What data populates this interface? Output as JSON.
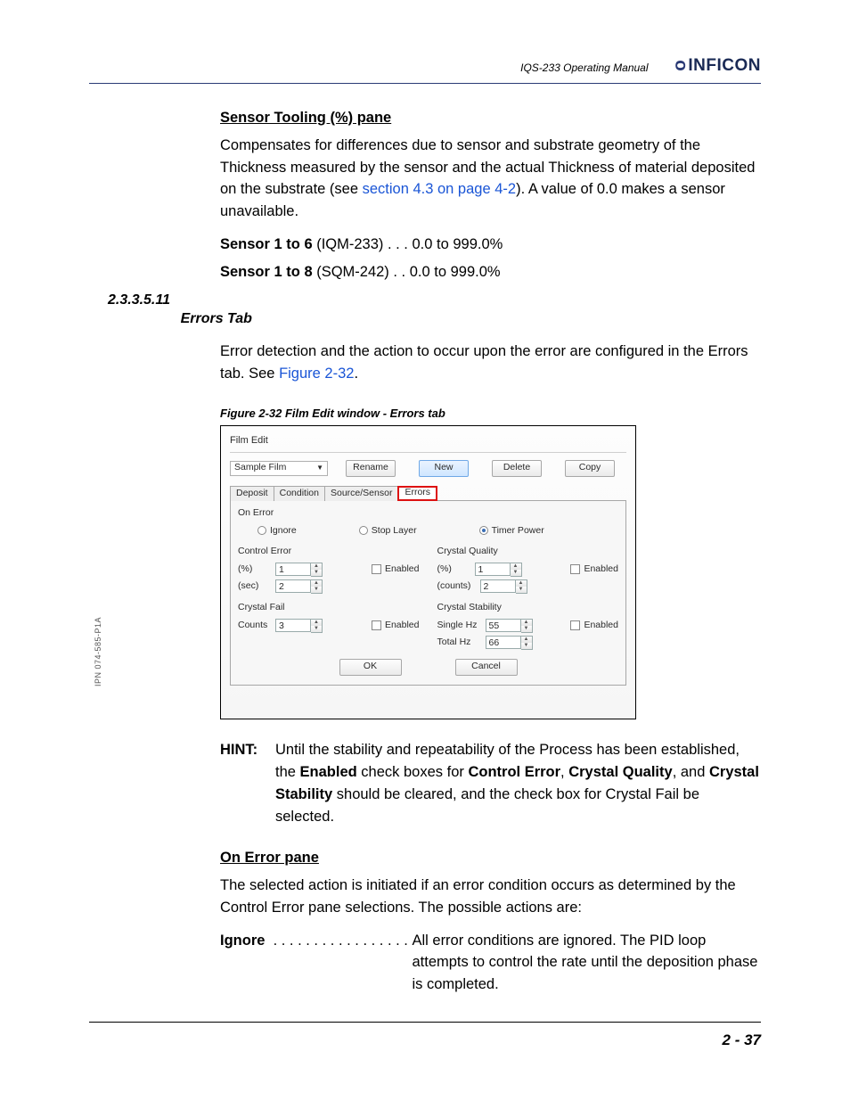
{
  "header": {
    "manual_title": "IQS-233 Operating Manual",
    "logo_text": "INFICON"
  },
  "sensor_tooling": {
    "heading": "Sensor Tooling (%) pane",
    "para1a": "Compensates for differences due to sensor and substrate geometry of the Thickness measured by the sensor and the actual Thickness of material deposited on the substrate (see ",
    "link": "section 4.3 on page 4-2",
    "para1b": "). A value of 0.0 makes a sensor unavailable.",
    "row1_bold": "Sensor 1 to 6",
    "row1_rest": " (IQM-233) . . . 0.0 to 999.0%",
    "row2_bold": "Sensor 1 to 8",
    "row2_rest": " (SQM-242)  . . 0.0 to 999.0%"
  },
  "section": {
    "number": "2.3.3.5.11",
    "title": "Errors Tab",
    "para_a": "Error detection and the action to occur upon the error are configured in the Errors tab. See ",
    "link": "Figure 2-32",
    "para_b": "."
  },
  "figure": {
    "caption": "Figure 2-32  Film Edit window - Errors tab",
    "window_title": "Film Edit",
    "select_value": "Sample Film",
    "buttons": {
      "rename": "Rename",
      "new": "New",
      "delete": "Delete",
      "copy": "Copy",
      "ok": "OK",
      "cancel": "Cancel"
    },
    "tabs": [
      "Deposit",
      "Condition",
      "Source/Sensor",
      "Errors"
    ],
    "on_error": {
      "title": "On Error",
      "ignore": "Ignore",
      "stop": "Stop Layer",
      "timer": "Timer Power"
    },
    "control_error": {
      "title": "Control Error",
      "pct_lbl": "(%)",
      "pct_val": "1",
      "sec_lbl": "(sec)",
      "sec_val": "2",
      "enabled": "Enabled"
    },
    "crystal_quality": {
      "title": "Crystal Quality",
      "pct_lbl": "(%)",
      "pct_val": "1",
      "cnt_lbl": "(counts)",
      "cnt_val": "2",
      "enabled": "Enabled"
    },
    "crystal_fail": {
      "title": "Crystal Fail",
      "cnt_lbl": "Counts",
      "cnt_val": "3",
      "enabled": "Enabled"
    },
    "crystal_stab": {
      "title": "Crystal Stability",
      "single_lbl": "Single Hz",
      "single_val": "55",
      "total_lbl": "Total Hz",
      "total_val": "66",
      "enabled": "Enabled"
    }
  },
  "hint": {
    "label": "HINT:",
    "t1": "Until the stability and repeatability of the Process has been established, the ",
    "b1": "Enabled",
    "t2": " check boxes for ",
    "b2": "Control Error",
    "t3": ", ",
    "b3": "Crystal Quality",
    "t4": ", and ",
    "b4": "Crystal Stability",
    "t5": " should be cleared, and the check box for Crystal Fail be selected."
  },
  "on_error_pane": {
    "heading": "On Error pane",
    "para": "The selected action is initiated if an error condition occurs as determined by the Control Error pane selections. The possible actions are:",
    "ignore_term": "Ignore",
    "ignore_dots": "  . . . . . . . . . . . . . . . . . ",
    "ignore_def": "All error conditions are ignored. The PID loop attempts to control the rate until the deposition phase is completed."
  },
  "footer": {
    "page": "2 - 37",
    "ipn": "IPN 074-585-P1A"
  }
}
